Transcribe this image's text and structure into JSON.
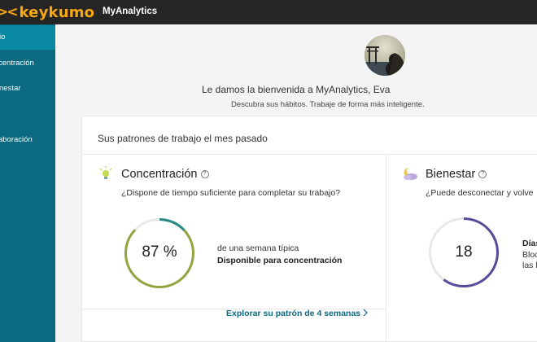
{
  "topbar": {
    "brand": "keykumo",
    "app_name": "MyAnalytics"
  },
  "sidebar": {
    "items": [
      {
        "label": "io",
        "active": true
      },
      {
        "label": "centración",
        "active": false
      },
      {
        "label": "nestar",
        "active": false
      },
      {
        "label": "",
        "active": false
      },
      {
        "label": "aboración",
        "active": false
      }
    ]
  },
  "welcome": {
    "title": "Le damos la bienvenida a MyAnalytics, Eva",
    "subtitle": "Descubra sus hábitos. Trabaje de forma más inteligente."
  },
  "panel": {
    "header": "Sus patrones de trabajo el mes pasado",
    "concentracion": {
      "title": "Concentración",
      "question": "¿Dispone de tiempo suficiente para completar su trabajo?",
      "ring_value": "87 %",
      "ring_fraction": 0.87,
      "detail_line1": "de una semana típica",
      "detail_line2": "Disponible para concentración",
      "explore_link": "Explorar su patrón de 4 semanas",
      "colors": {
        "ring_main": "#8fa640",
        "ring_accent": "#2a8a8a"
      }
    },
    "bienestar": {
      "title": "Bienestar",
      "question": "¿Puede desconectar y volve",
      "ring_value": "18",
      "ring_fraction": 0.6,
      "detail_line1": "Días",
      "detail_line2": "Bloc",
      "detail_line3": "las h",
      "colors": {
        "ring_main": "#5a4a9a"
      }
    }
  }
}
